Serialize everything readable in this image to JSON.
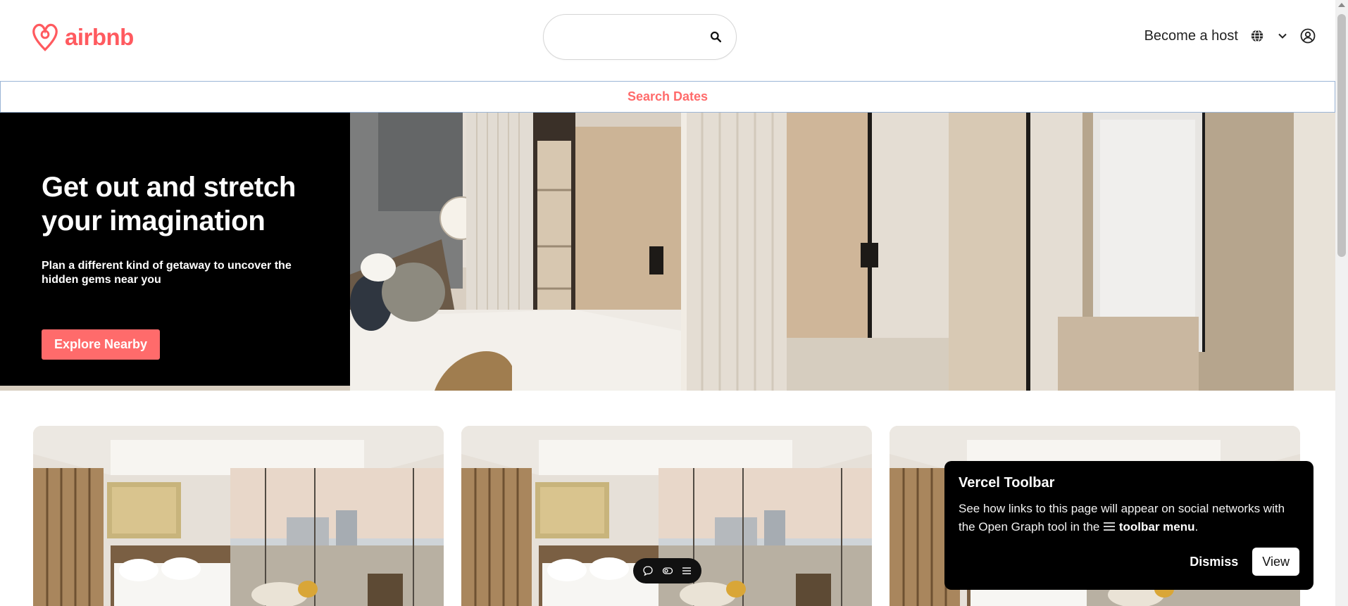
{
  "brand": {
    "name": "airbnb",
    "color": "#FF5A5F"
  },
  "search": {
    "value": "",
    "placeholder": ""
  },
  "header": {
    "host_label": "Become a host"
  },
  "dates_bar": {
    "label": "Search Dates"
  },
  "hero": {
    "title_line1": "Get out and stretch",
    "title_line2": "your imagination",
    "subtitle": "Plan a different kind of getaway to uncover the hidden gems near you",
    "cta": "Explore Nearby"
  },
  "popup": {
    "title": "Vercel Toolbar",
    "body_before": "See how links to this page will appear on social networks with the Open Graph tool in the",
    "body_bold": "toolbar menu",
    "body_after": ".",
    "dismiss": "Dismiss",
    "view": "View"
  },
  "colors": {
    "accent": "#FF6B6B",
    "popup_bg": "#000000"
  }
}
